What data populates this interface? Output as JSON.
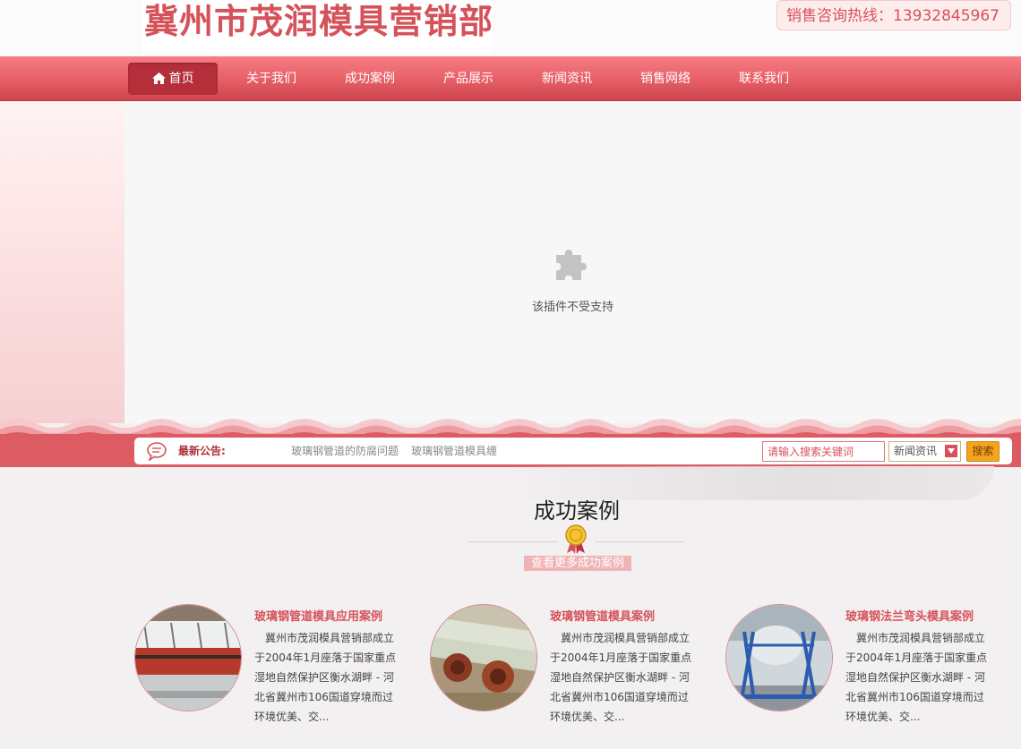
{
  "header": {
    "logo_text": "冀州市茂润模具营销部",
    "hotline": "销售咨询热线：13932845967"
  },
  "nav": {
    "items": [
      {
        "label": "首页",
        "icon": "home-icon",
        "active": true
      },
      {
        "label": "关于我们"
      },
      {
        "label": "成功案例"
      },
      {
        "label": "产品展示"
      },
      {
        "label": "新闻资讯"
      },
      {
        "label": "销售网络"
      },
      {
        "label": "联系我们"
      }
    ]
  },
  "banner": {
    "plugin_icon": "puzzle-piece-icon",
    "plugin_message": "该插件不受支持"
  },
  "notice": {
    "icon": "speech-bubble-icon",
    "label": "最新公告:",
    "items": [
      "玻璃钢管道的防腐问题",
      "玻璃钢管道模具缠"
    ]
  },
  "search": {
    "placeholder": "请输入搜索关键词",
    "category": "新闻资讯",
    "button_label": "搜索"
  },
  "cases_section": {
    "title": "成功案例",
    "icon": "medal-icon",
    "more_link": "查看更多成功案例",
    "items": [
      {
        "title": "玻璃钢管道模具应用案例",
        "description": "冀州市茂润模具营销部成立于2004年1月座落于国家重点湿地自然保护区衡水湖畔 - 河北省冀州市106国道穿境而过环境优美、交..."
      },
      {
        "title": "玻璃钢管道模具案例",
        "description": "冀州市茂润模具营销部成立于2004年1月座落于国家重点湿地自然保护区衡水湖畔 - 河北省冀州市106国道穿境而过环境优美、交..."
      },
      {
        "title": "玻璃钢法兰弯头模具案例",
        "description": "冀州市茂润模具营销部成立于2004年1月座落于国家重点湿地自然保护区衡水湖畔 - 河北省冀州市106国道穿境而过环境优美、交..."
      }
    ]
  },
  "colors": {
    "brand_red": "#d6525a",
    "nav_active": "#b42f39",
    "search_button": "#f3a51f"
  }
}
